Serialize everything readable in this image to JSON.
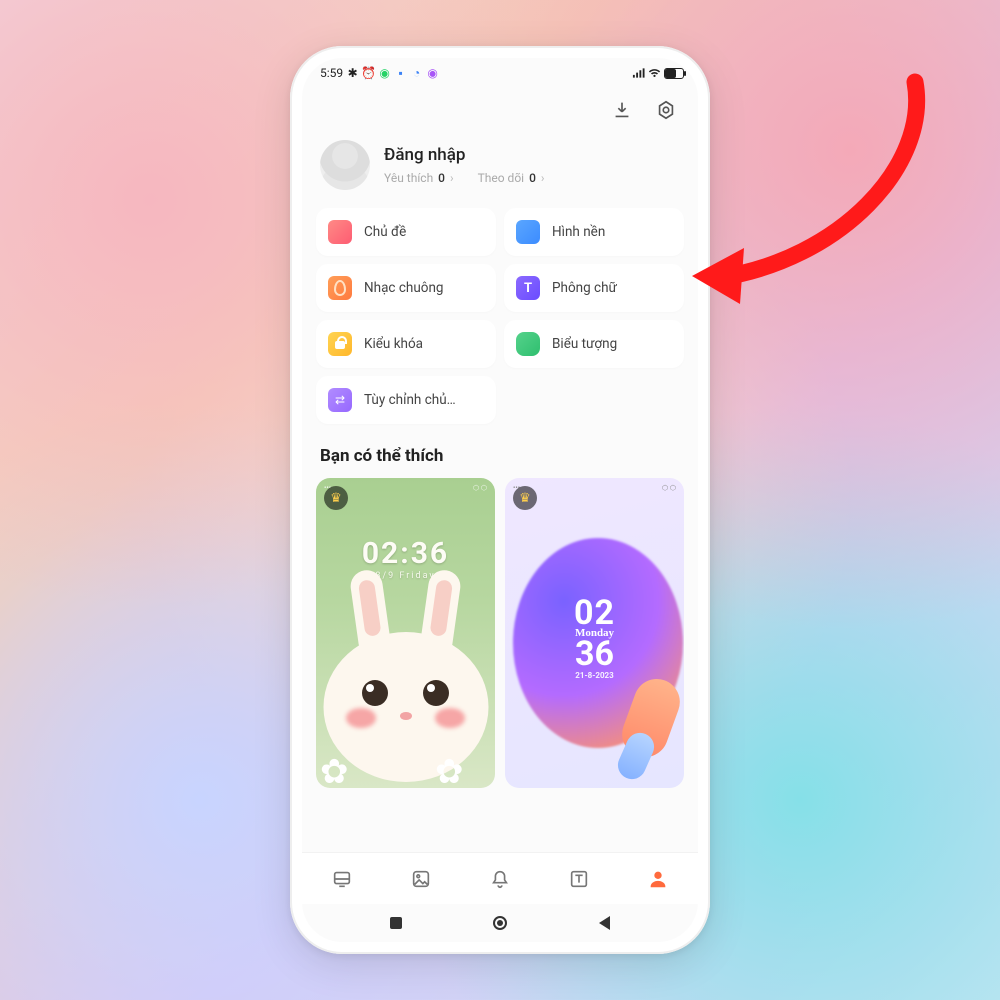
{
  "statusbar": {
    "time": "5:59",
    "battery": "69"
  },
  "profile": {
    "login_label": "Đăng nhập",
    "favorites_label": "Yêu thích",
    "favorites_count": "0",
    "following_label": "Theo dõi",
    "following_count": "0"
  },
  "categories": {
    "theme": "Chủ đề",
    "wallpaper": "Hình nền",
    "ringtone": "Nhạc chuông",
    "font": "Phông chữ",
    "lock": "Kiểu khóa",
    "iconset": "Biểu tượng",
    "custom": "Tùy chỉnh chủ…"
  },
  "section_recommend": "Bạn có thể thích",
  "cards": {
    "bunny": {
      "time": "02:36",
      "date": "8/9 Friday"
    },
    "gradient": {
      "h": "02",
      "m": "36",
      "day": "Monday",
      "date": "21-8-2023"
    }
  },
  "arrow_target": "categories.wallpaper"
}
